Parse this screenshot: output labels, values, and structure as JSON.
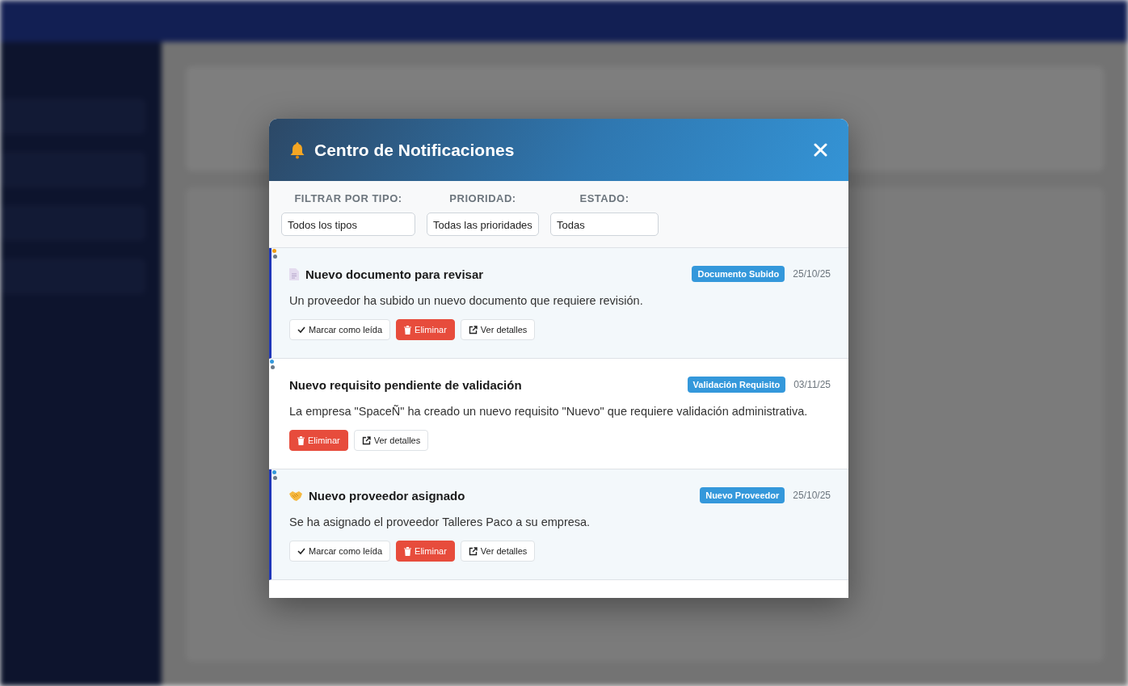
{
  "modal": {
    "title": "Centro de Notificaciones",
    "filters": [
      {
        "label": "FILTRAR POR TIPO:",
        "value": "Todos los tipos"
      },
      {
        "label": "PRIORIDAD:",
        "value": "Todas las prioridades"
      },
      {
        "label": "ESTADO:",
        "value": "Todas"
      }
    ],
    "notifications": [
      {
        "kind": "document",
        "read": false,
        "color": "#f39c12",
        "title": "Nuevo documento para revisar",
        "tag": "Documento Subido",
        "date": "25/10/25",
        "body": "Un proveedor ha subido un nuevo documento que requiere revisión.",
        "actions": [
          {
            "kind": "mark",
            "label": "Marcar como leída"
          },
          {
            "kind": "delete",
            "label": "Eliminar"
          },
          {
            "kind": "details",
            "label": "Ver detalles"
          }
        ]
      },
      {
        "kind": "none",
        "read": true,
        "color": "#3498db",
        "title": "Nuevo requisito pendiente de validación",
        "tag": "Validación Requisito",
        "date": "03/11/25",
        "body": "La empresa \"SpaceÑ\" ha creado un nuevo requisito \"Nuevo\" que requiere validación administrativa.",
        "actions": [
          {
            "kind": "delete",
            "label": "Eliminar"
          },
          {
            "kind": "details",
            "label": "Ver detalles"
          }
        ]
      },
      {
        "kind": "handshake",
        "read": false,
        "color": "#3498db",
        "title": "Nuevo proveedor asignado",
        "tag": "Nuevo Proveedor",
        "date": "25/10/25",
        "body": "Se ha asignado el proveedor Talleres Paco a su empresa.",
        "actions": [
          {
            "kind": "mark",
            "label": "Marcar como leída"
          },
          {
            "kind": "delete",
            "label": "Eliminar"
          },
          {
            "kind": "details",
            "label": "Ver detalles"
          }
        ]
      }
    ]
  }
}
